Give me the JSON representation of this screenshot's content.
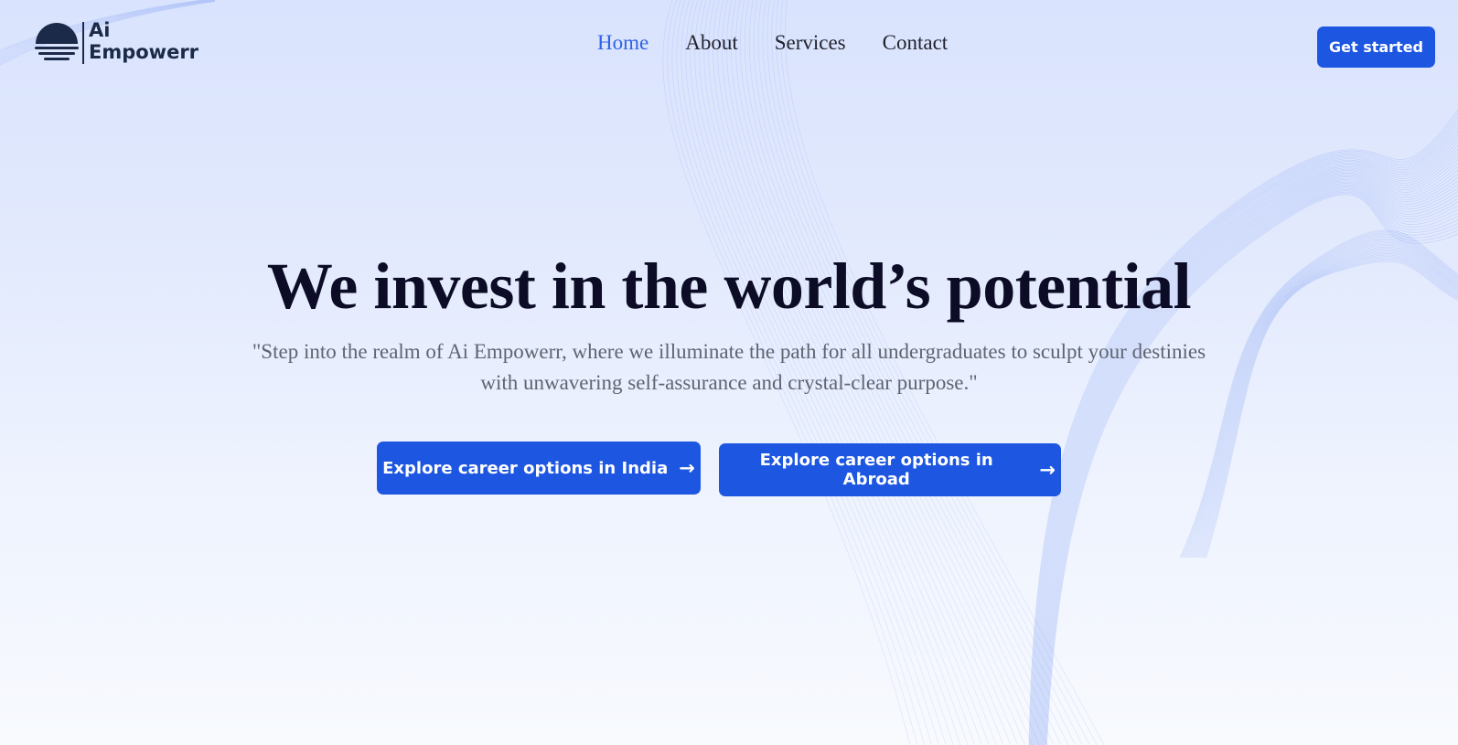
{
  "brand": {
    "line1": "Ai",
    "line2": "Empowerr",
    "color": "#1b2a48"
  },
  "nav": {
    "items": [
      "Home",
      "About",
      "Services",
      "Contact"
    ],
    "active": "Home",
    "active_color": "#2d62e6"
  },
  "header": {
    "cta_label": "Get started"
  },
  "hero": {
    "title": "We invest in the world’s potential",
    "subtitle": "\"Step into the realm of Ai Empowerr, where we illuminate the path for all undergraduates to sculpt your destinies with unwavering self-assurance and crystal-clear purpose.\"",
    "cta_india": "Explore career options in India",
    "cta_abroad": "Explore career options in Abroad",
    "arrow_icon": "arrow-right-icon"
  },
  "colors": {
    "accent": "#1d56e1",
    "background": "#dfe7fd",
    "wave": "#5b82f0"
  }
}
